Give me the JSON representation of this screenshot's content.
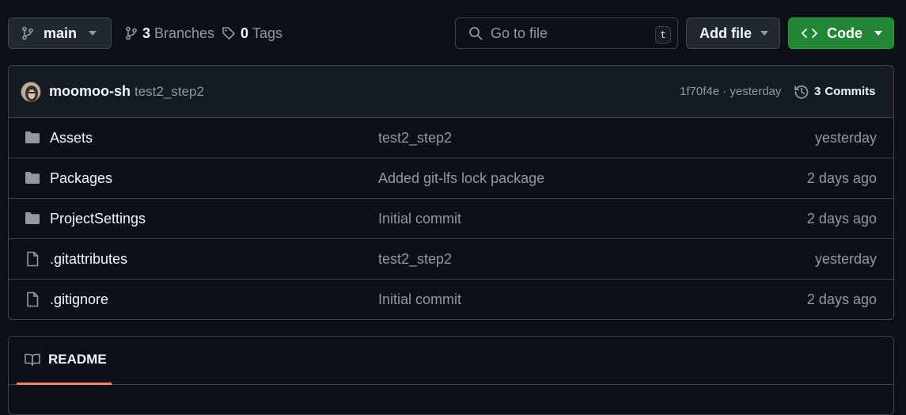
{
  "toolbar": {
    "branch": {
      "label": "main",
      "icon": "git-branch-icon"
    },
    "branches": {
      "count": "3",
      "label": "Branches",
      "icon": "git-branch-icon"
    },
    "tags": {
      "count": "0",
      "label": "Tags",
      "icon": "tag-icon"
    },
    "search": {
      "placeholder": "Go to file",
      "shortcut": "t",
      "icon": "search-icon"
    },
    "add_file": {
      "label": "Add file"
    },
    "code": {
      "label": "Code",
      "icon": "code-icon"
    }
  },
  "commit": {
    "author": "moomoo-sh",
    "message": "test2_step2",
    "hash": "1f70f4e",
    "separator": "·",
    "time": "yesterday",
    "commits_count": "3",
    "commits_label": "Commits",
    "icon": "history-icon"
  },
  "files": [
    {
      "type": "folder",
      "icon": "folder-icon",
      "name": "Assets",
      "message": "test2_step2",
      "date": "yesterday"
    },
    {
      "type": "folder",
      "icon": "folder-icon",
      "name": "Packages",
      "message": "Added git-lfs lock package",
      "date": "2 days ago"
    },
    {
      "type": "folder",
      "icon": "folder-icon",
      "name": "ProjectSettings",
      "message": "Initial commit",
      "date": "2 days ago"
    },
    {
      "type": "file",
      "icon": "file-icon",
      "name": ".gitattributes",
      "message": "test2_step2",
      "date": "yesterday"
    },
    {
      "type": "file",
      "icon": "file-icon",
      "name": ".gitignore",
      "message": "Initial commit",
      "date": "2 days ago"
    }
  ],
  "readme": {
    "tab_label": "README",
    "icon": "book-icon"
  },
  "colors": {
    "background": "#0d1117",
    "border": "#3d444d",
    "primary_button": "#238636",
    "tab_underline": "#f78166",
    "muted_text": "#9198a1"
  }
}
